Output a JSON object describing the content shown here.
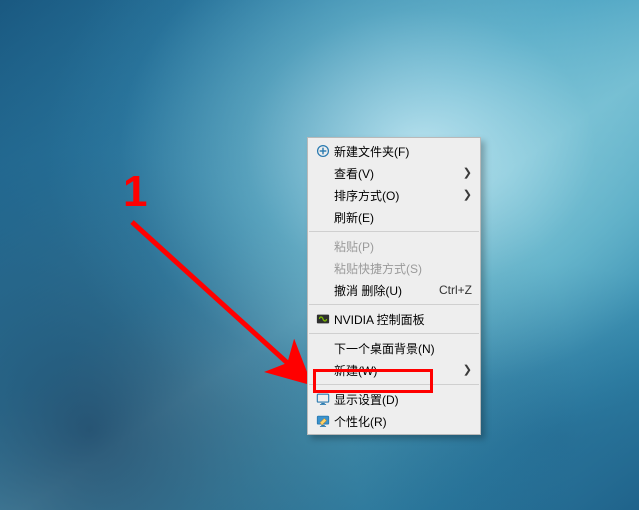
{
  "annotation": {
    "number": "1"
  },
  "menu": {
    "items": [
      {
        "label": "新建文件夹(F)",
        "shortcut": "",
        "submenu": false,
        "disabled": false,
        "icon": "folder-new-icon"
      },
      {
        "label": "查看(V)",
        "shortcut": "",
        "submenu": true,
        "disabled": false,
        "icon": ""
      },
      {
        "label": "排序方式(O)",
        "shortcut": "",
        "submenu": true,
        "disabled": false,
        "icon": ""
      },
      {
        "label": "刷新(E)",
        "shortcut": "",
        "submenu": false,
        "disabled": false,
        "icon": ""
      },
      {
        "separator": true
      },
      {
        "label": "粘贴(P)",
        "shortcut": "",
        "submenu": false,
        "disabled": true,
        "icon": ""
      },
      {
        "label": "粘贴快捷方式(S)",
        "shortcut": "",
        "submenu": false,
        "disabled": true,
        "icon": ""
      },
      {
        "label": "撤消 删除(U)",
        "shortcut": "Ctrl+Z",
        "submenu": false,
        "disabled": false,
        "icon": ""
      },
      {
        "separator": true
      },
      {
        "label": "NVIDIA 控制面板",
        "shortcut": "",
        "submenu": false,
        "disabled": false,
        "icon": "nvidia-icon"
      },
      {
        "separator": true
      },
      {
        "label": "下一个桌面背景(N)",
        "shortcut": "",
        "submenu": false,
        "disabled": false,
        "icon": ""
      },
      {
        "label": "新建(W)",
        "shortcut": "",
        "submenu": true,
        "disabled": false,
        "icon": ""
      },
      {
        "separator": true
      },
      {
        "label": "显示设置(D)",
        "shortcut": "",
        "submenu": false,
        "disabled": false,
        "icon": "display-settings-icon"
      },
      {
        "label": "个性化(R)",
        "shortcut": "",
        "submenu": false,
        "disabled": false,
        "icon": "personalize-icon"
      }
    ]
  }
}
